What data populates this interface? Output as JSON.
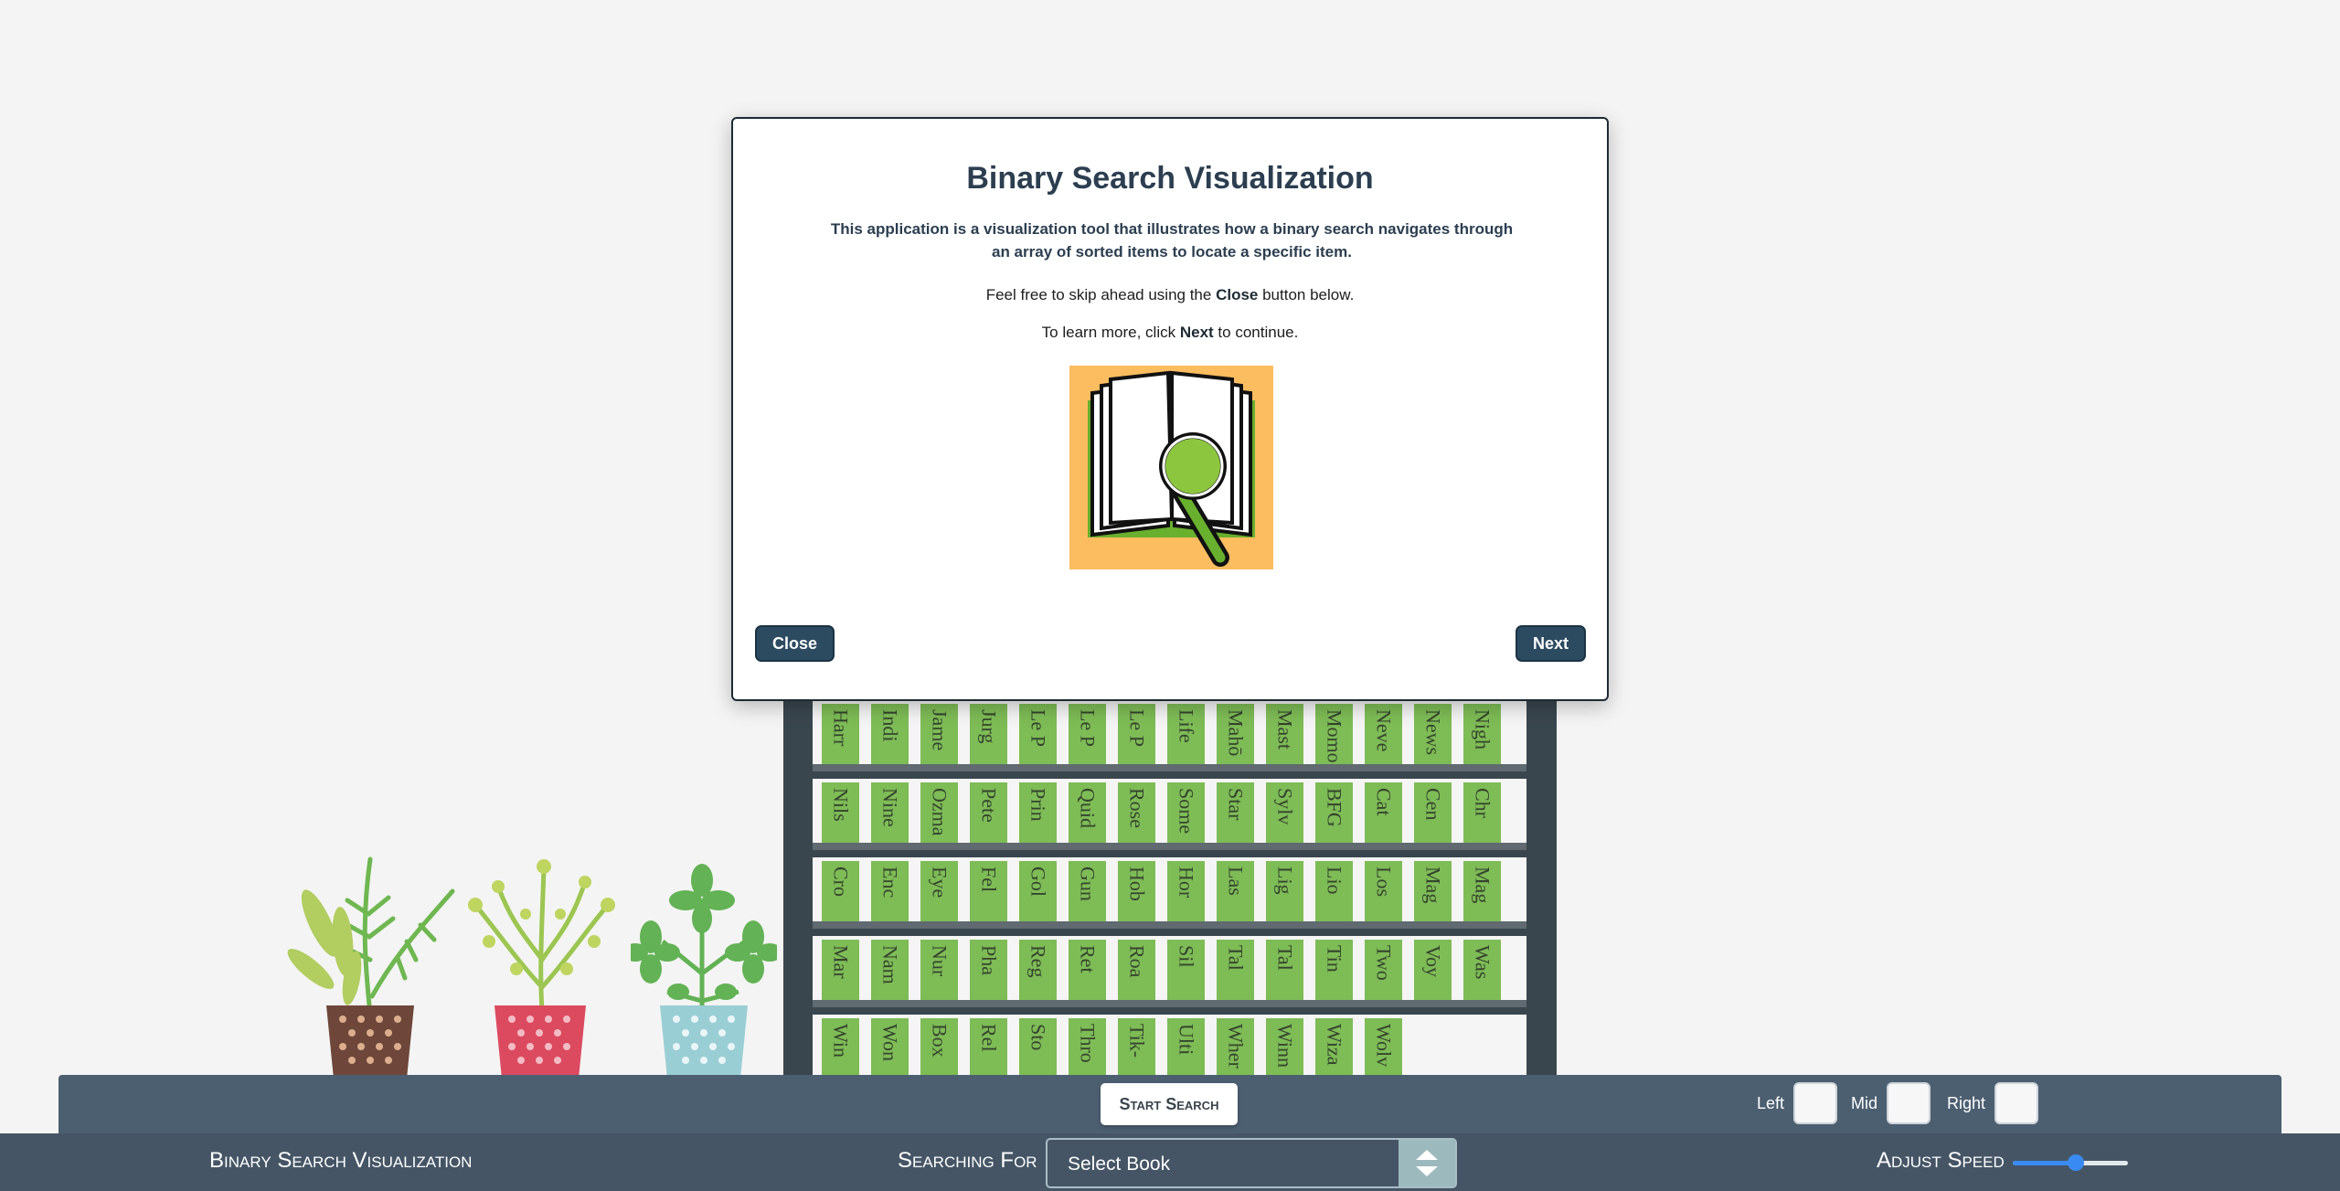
{
  "shelves": [
    [
      "Harr",
      "Indi",
      "Jame",
      "Jurg",
      "Le P",
      "Le P",
      "Le P",
      "Life",
      "Mahō",
      "Mast",
      "Momo",
      "Neve",
      "News",
      "Nigh"
    ],
    [
      "Nils",
      "Nine",
      "Ozma",
      "Pete",
      "Prin",
      "Quid",
      "Rose",
      "Some",
      "Star",
      "Sylv",
      "BFG",
      "Cat",
      "Cen",
      "Chr"
    ],
    [
      "Cro",
      "Enc",
      "Eye",
      "Fel",
      "Gol",
      "Gun",
      "Hob",
      "Hor",
      "Las",
      "Lig",
      "Lio",
      "Los",
      "Mag",
      "Mag"
    ],
    [
      "Mar",
      "Nam",
      "Nur",
      "Pha",
      "Reg",
      "Ret",
      "Roa",
      "Sil",
      "Tal",
      "Tal",
      "Tin",
      "Two",
      "Voy",
      "Was"
    ],
    [
      "Win",
      "Won",
      "Box",
      "Rel",
      "Sto",
      "Thro",
      "Tik-",
      "Ulti",
      "Wher",
      "Winn",
      "Wiza",
      "Wolv"
    ]
  ],
  "controls": {
    "start_label": "Start Search",
    "left_label": "Left",
    "mid_label": "Mid",
    "right_label": "Right"
  },
  "footer": {
    "title": "Binary Search Visualization",
    "searching_label": "Searching For",
    "select_value": "Select Book",
    "speed_label": "Adjust Speed",
    "speed_value": 0.55,
    "accent_color": "#1e7cf2"
  },
  "modal": {
    "title": "Binary Search Visualization",
    "description": "This application is a visualization tool that illustrates how a binary search navigates through an array of sorted items to locate a specific item.",
    "skip_pre": "Feel free to skip ahead using the ",
    "skip_bold": "Close",
    "skip_post": " button below.",
    "learn_pre": "To learn more, click ",
    "learn_bold": "Next",
    "learn_post": " to continue.",
    "image_icon": "book-magnifier-icon",
    "close_label": "Close",
    "next_label": "Next"
  },
  "colors": {
    "book": "#6db33f",
    "panel": "#34495e",
    "footer": "#2c3e50",
    "bookcase": "#1f2d36"
  }
}
